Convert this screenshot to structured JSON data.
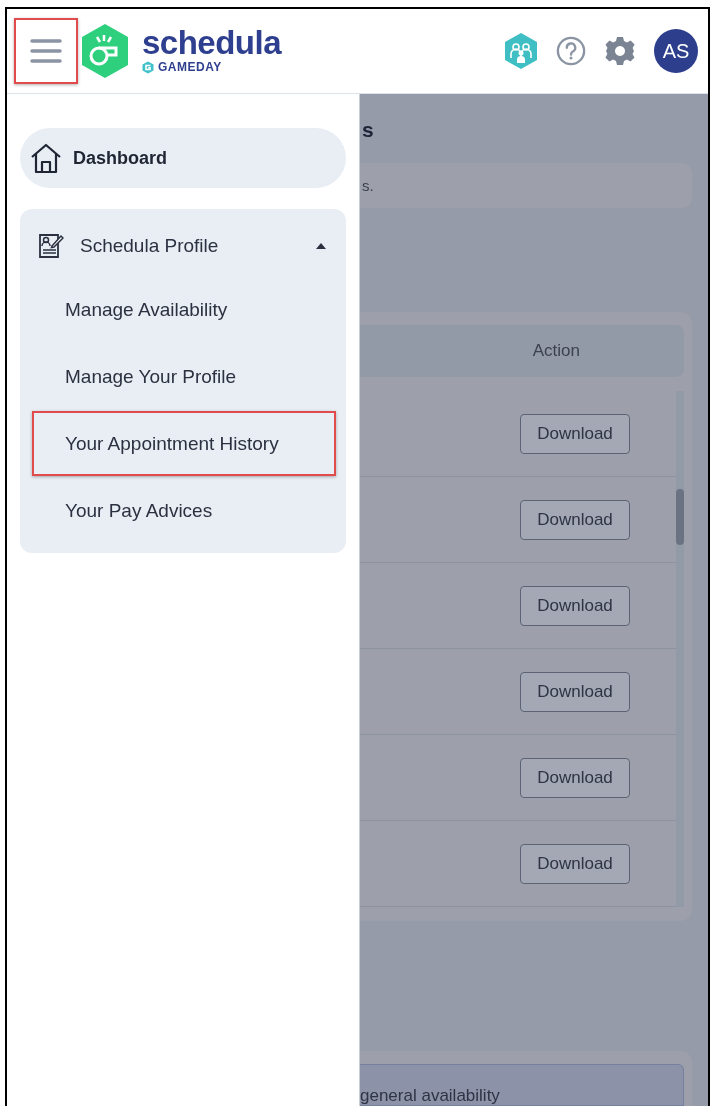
{
  "header": {
    "menu_button": {
      "annotated": true
    },
    "logo": {
      "name": "schedula",
      "tagline": "GAMEDAY"
    },
    "avatar": {
      "initials": "AS"
    }
  },
  "sidebar": {
    "items": [
      {
        "label": "Dashboard",
        "kind": "link",
        "selected": true
      },
      {
        "label": "Schedula Profile",
        "kind": "group",
        "selected": false,
        "expanded": true,
        "children": [
          {
            "label": "Manage Availability",
            "annotated": false
          },
          {
            "label": "Manage Your Profile",
            "annotated": false
          },
          {
            "label": "Your Appointment History",
            "annotated": true
          },
          {
            "label": "Your Pay Advices",
            "annotated": false
          }
        ]
      }
    ]
  },
  "background": {
    "heading": "s",
    "notice": "s.",
    "table": {
      "columns": [
        "Action"
      ],
      "rows": [
        {
          "action": "Download"
        },
        {
          "action": "Download"
        },
        {
          "action": "Download"
        },
        {
          "action": "Download"
        },
        {
          "action": "Download"
        },
        {
          "action": "Download"
        }
      ]
    },
    "footer_text": "general availability"
  }
}
